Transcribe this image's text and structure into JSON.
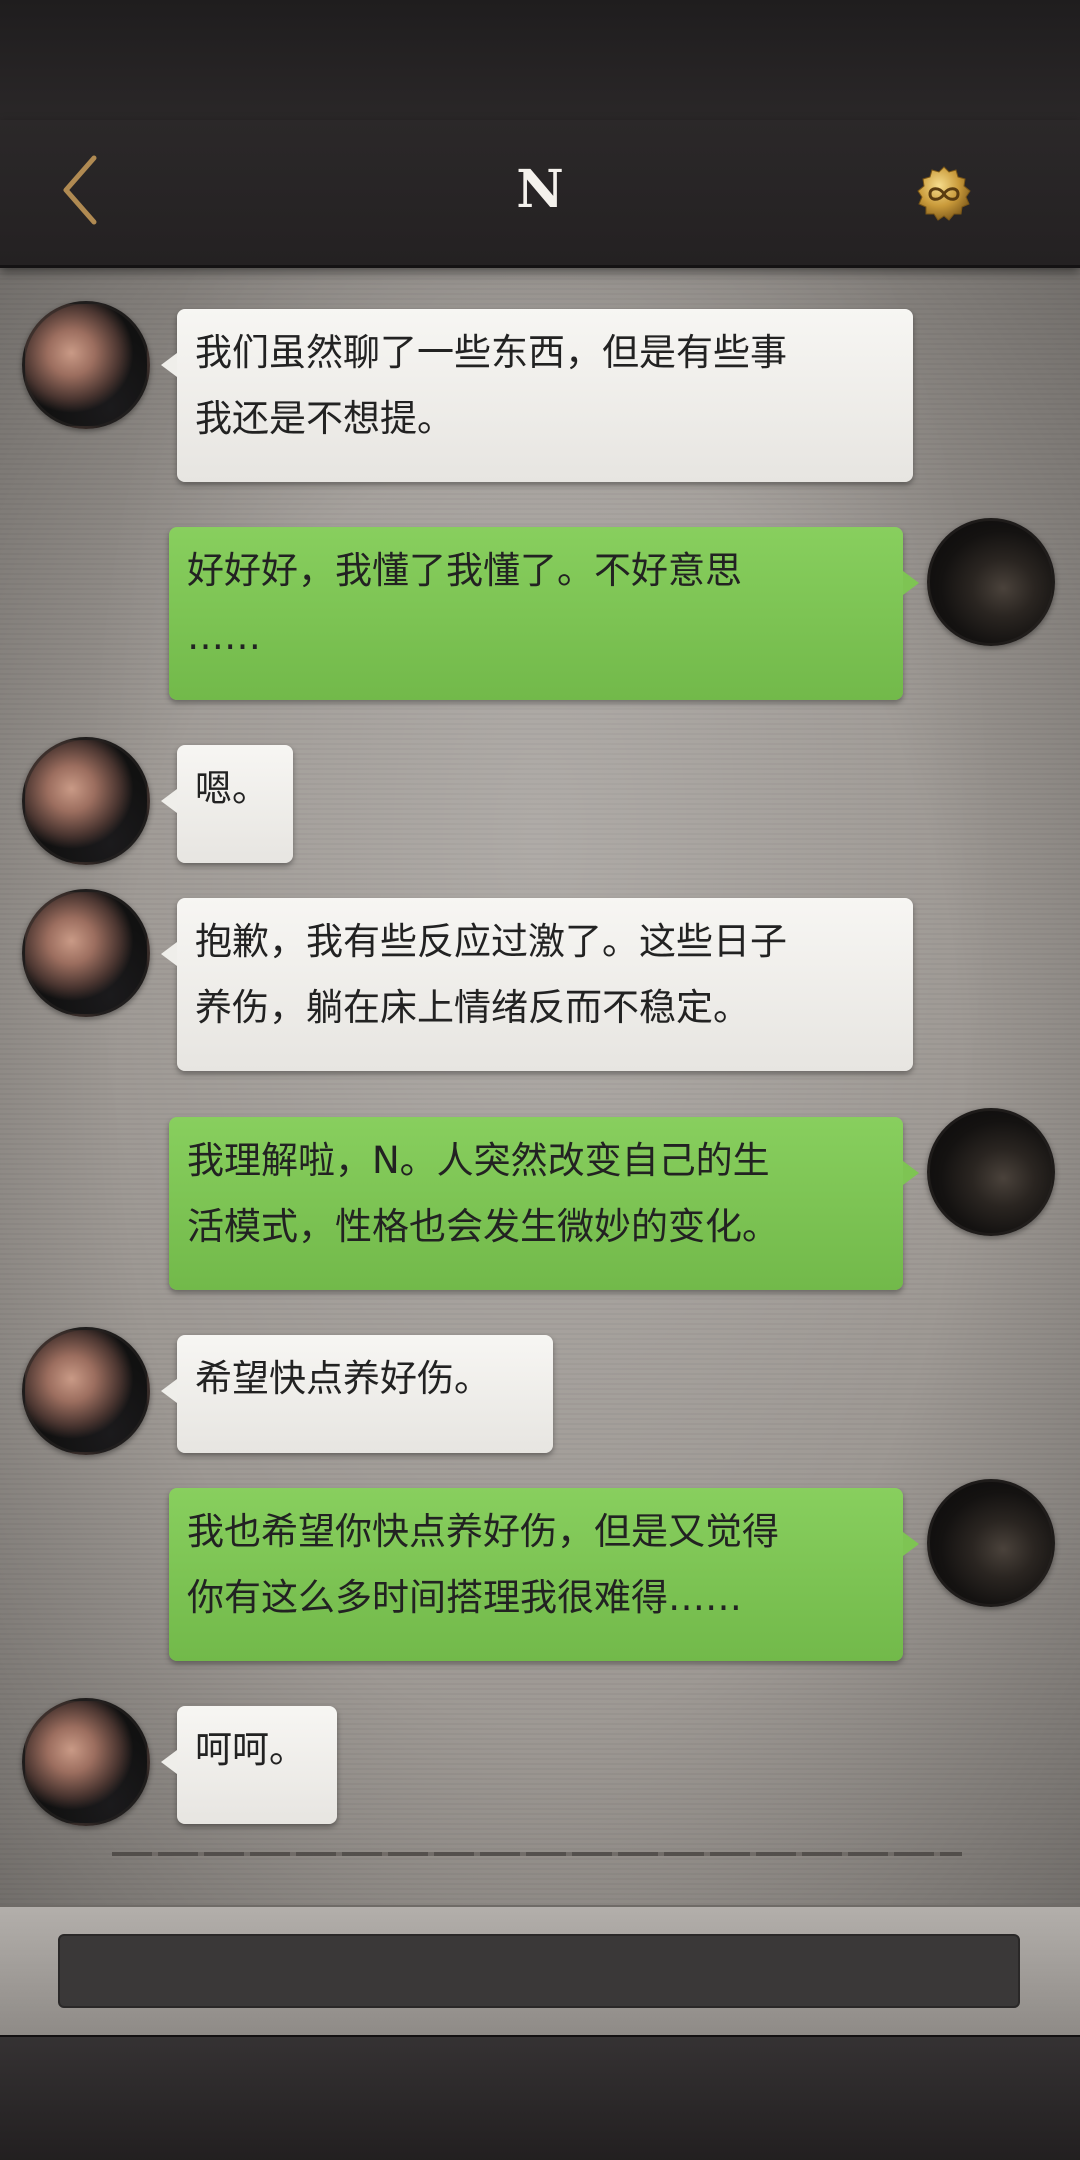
{
  "header": {
    "title": "N",
    "back_icon": "chevron-left-icon",
    "badge_icon": "infinity-coin-icon",
    "accent_color": "#b08a52"
  },
  "messages": [
    {
      "sender": "N",
      "text": "我们虽然聊了一些东西，但是有些事\n我还是不想提。"
    },
    {
      "sender": "me",
      "text": "好好好，我懂了我懂了。不好意思\n……"
    },
    {
      "sender": "N",
      "text": "嗯。"
    },
    {
      "sender": "N",
      "text": "抱歉，我有些反应过激了。这些日子\n养伤，躺在床上情绪反而不稳定。"
    },
    {
      "sender": "me",
      "text": "我理解啦，N。人突然改变自己的生\n活模式，性格也会发生微妙的变化。"
    },
    {
      "sender": "N",
      "text": "希望快点养好伤。"
    },
    {
      "sender": "me",
      "text": "我也希望你快点养好伤，但是又觉得\n你有这么多时间搭理我很难得……"
    },
    {
      "sender": "N",
      "text": "呵呵。"
    }
  ],
  "input": {
    "value": ""
  },
  "colors": {
    "incoming_bubble": "#efeeea",
    "outgoing_bubble": "#7ec453"
  }
}
